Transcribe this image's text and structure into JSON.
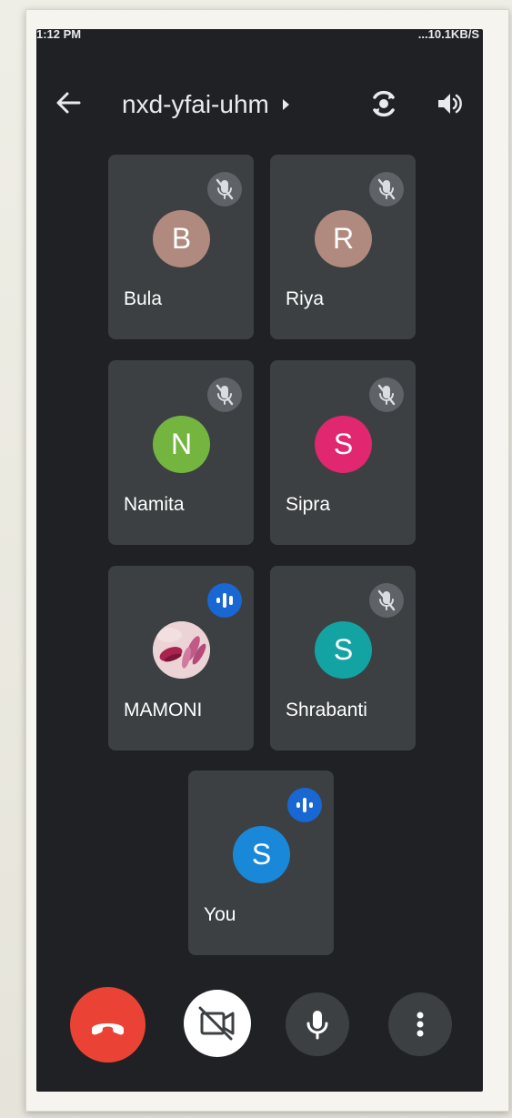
{
  "status_bar": {
    "time": "1:12 PM",
    "right": "...10.1KB/S"
  },
  "topbar": {
    "meeting_code": "nxd-yfai-uhm",
    "icons": [
      "back-arrow-icon",
      "chevron-right-icon",
      "switch-camera-icon",
      "speaker-icon"
    ]
  },
  "participants": [
    {
      "name": "Bula",
      "initial": "B",
      "avatar_color": "#b08a7e",
      "status": "muted"
    },
    {
      "name": "Riya",
      "initial": "R",
      "avatar_color": "#b08a7e",
      "status": "muted"
    },
    {
      "name": "Namita",
      "initial": "N",
      "avatar_color": "#74b53f",
      "status": "muted"
    },
    {
      "name": "Sipra",
      "initial": "S",
      "avatar_color": "#e0276f",
      "status": "muted"
    },
    {
      "name": "MAMONI",
      "initial": "",
      "avatar_color": "#c86a8c",
      "status": "speaking"
    },
    {
      "name": "Shrabanti",
      "initial": "S",
      "avatar_color": "#14a3a3",
      "status": "muted"
    },
    {
      "name": "You",
      "initial": "S",
      "avatar_color": "#1a88d8",
      "status": "speaking"
    }
  ],
  "controls": {
    "end_call": {
      "icon": "end-call-icon",
      "color": "#ea4335"
    },
    "camera": {
      "icon": "camera-off-icon",
      "color": "#ffffff"
    },
    "mic": {
      "icon": "microphone-icon",
      "color": "#3c4043"
    },
    "more": {
      "icon": "more-vert-icon",
      "color": "#3c4043"
    }
  },
  "colors": {
    "background": "#202124",
    "tile": "#3c4043",
    "mute_badge": "#5f6368",
    "speaking_badge": "#1967d2"
  }
}
